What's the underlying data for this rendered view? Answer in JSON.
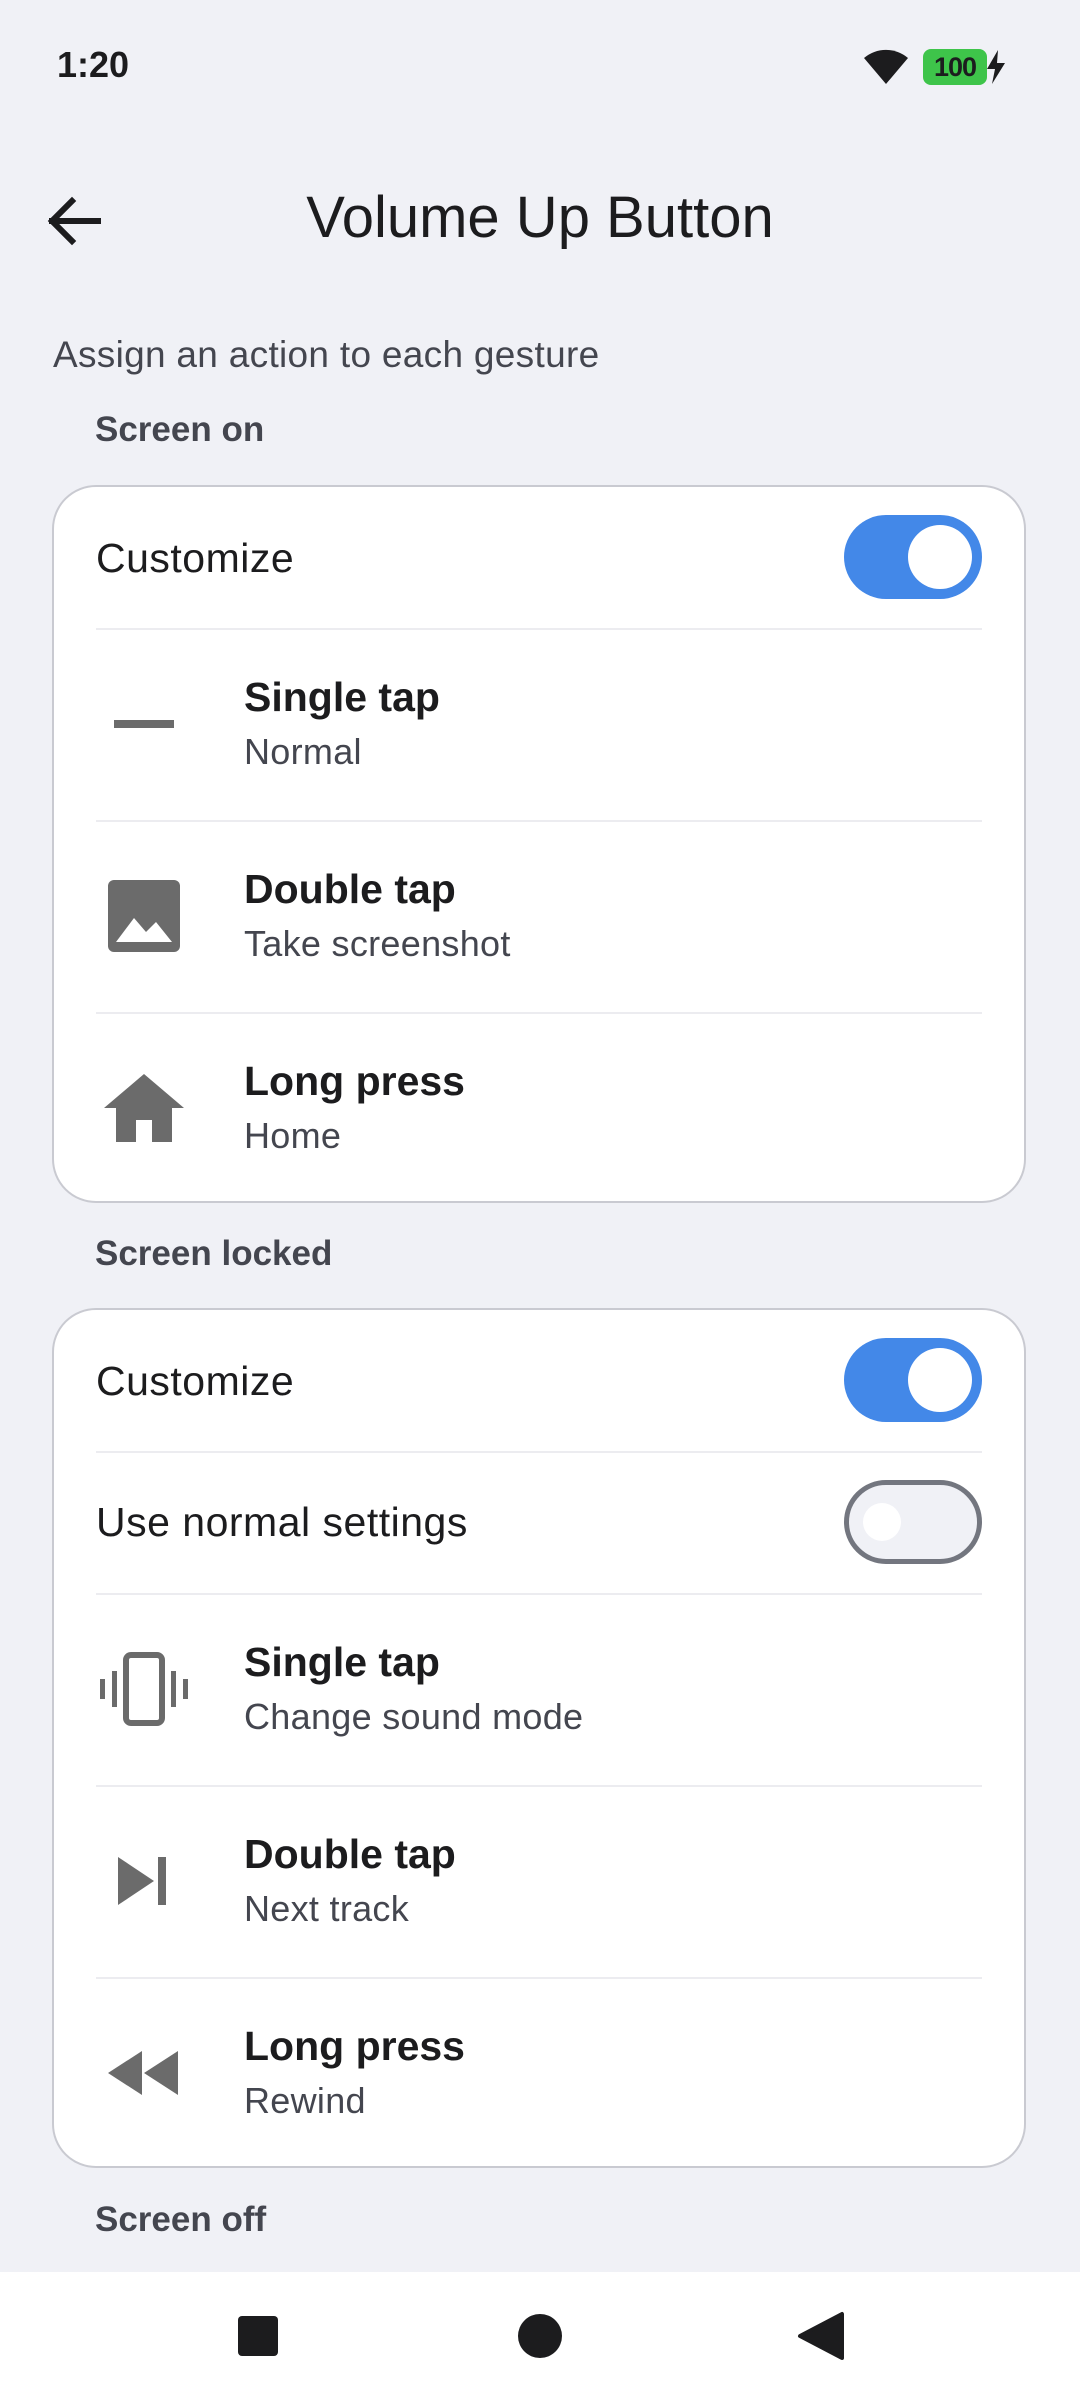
{
  "status_bar": {
    "time": "1:20",
    "battery": "100",
    "battery_color": "#3ec44a",
    "icons": [
      "wifi-icon",
      "battery-icon",
      "charging-bolt-icon"
    ]
  },
  "app_bar": {
    "back_icon": "arrow-back-icon",
    "title": "Volume Up Button"
  },
  "subtitle": "Assign an action to each gesture",
  "accent_color": "#4388e8",
  "sections": {
    "screen_on": {
      "header": "Screen on",
      "customize_label": "Customize",
      "customize_on": true,
      "gestures": [
        {
          "title": "Single tap",
          "value": "Normal",
          "icon": "dash-icon"
        },
        {
          "title": "Double tap",
          "value": "Take screenshot",
          "icon": "image-icon"
        },
        {
          "title": "Long press",
          "value": "Home",
          "icon": "home-icon"
        }
      ]
    },
    "screen_locked": {
      "header": "Screen locked",
      "customize_label": "Customize",
      "customize_on": true,
      "normal_label": "Use normal settings",
      "normal_on": false,
      "gestures": [
        {
          "title": "Single tap",
          "value": "Change sound mode",
          "icon": "vibrate-icon"
        },
        {
          "title": "Double tap",
          "value": "Next track",
          "icon": "skip-next-icon"
        },
        {
          "title": "Long press",
          "value": "Rewind",
          "icon": "rewind-icon"
        }
      ]
    },
    "screen_off": {
      "header": "Screen off"
    }
  },
  "nav_bar": {
    "buttons": [
      "recents-square-icon",
      "home-circle-icon",
      "back-triangle-icon"
    ]
  }
}
